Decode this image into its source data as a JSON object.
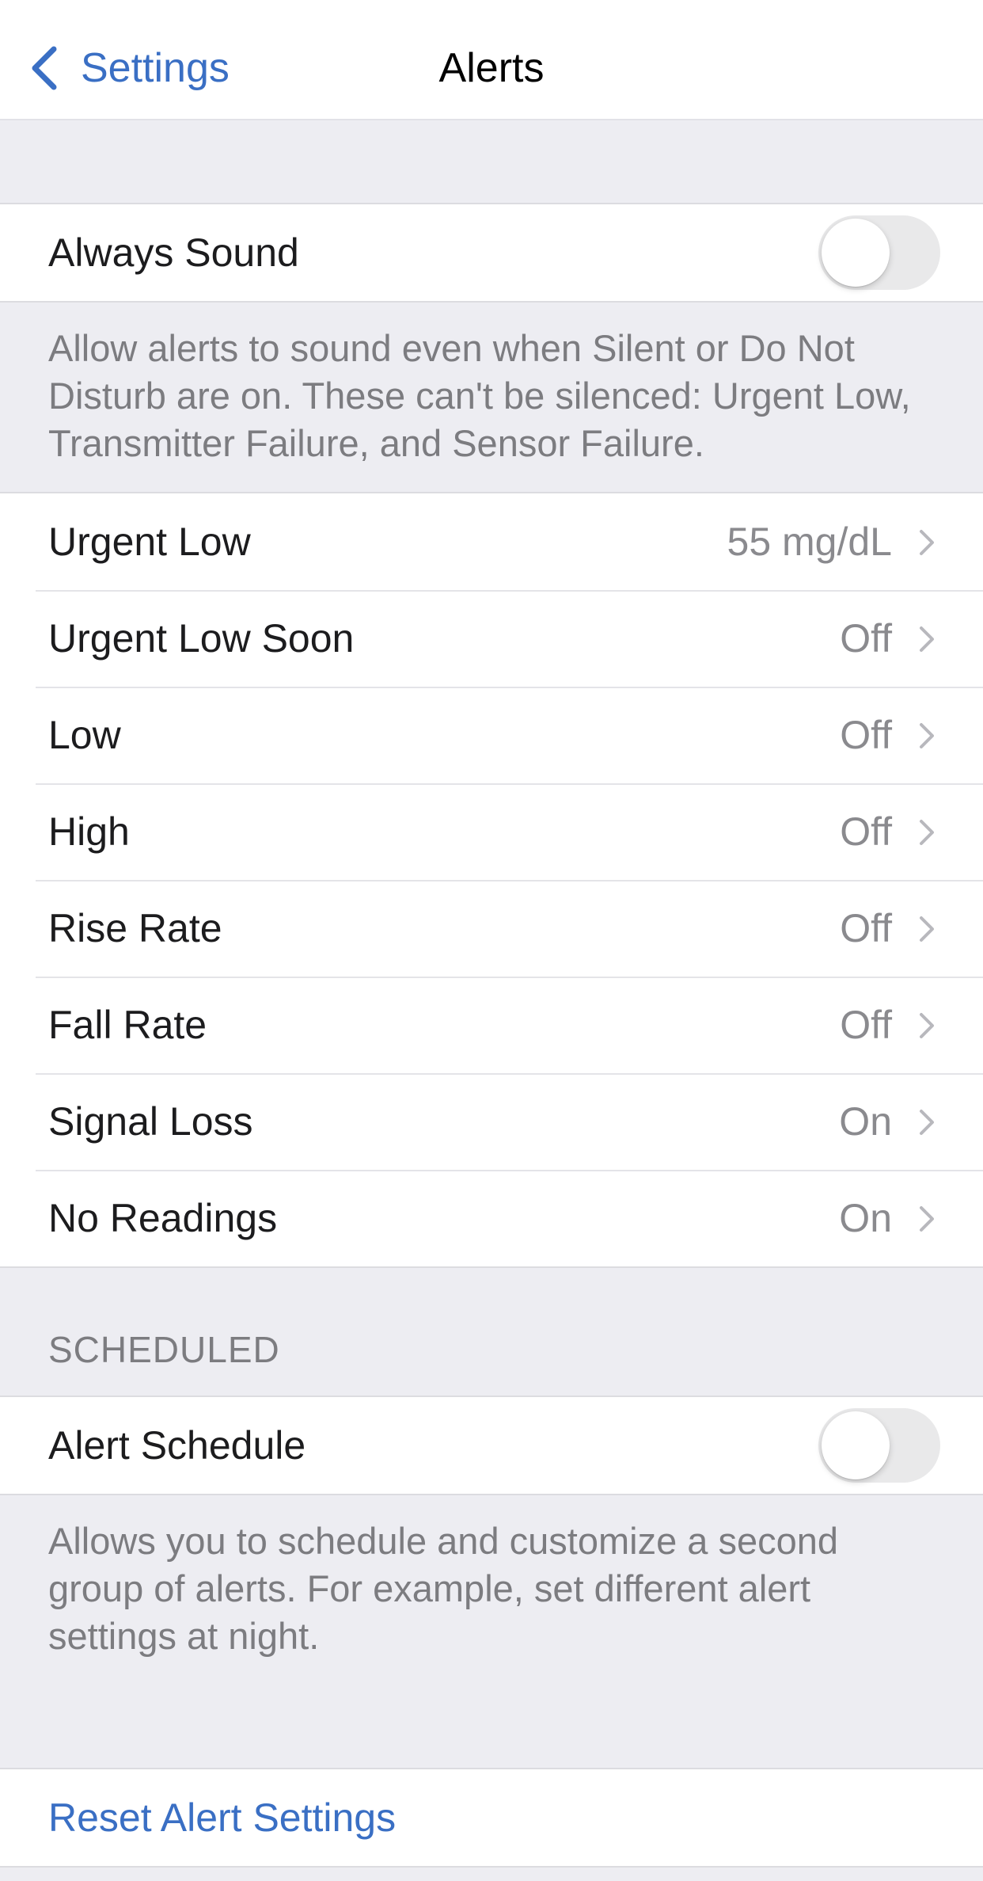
{
  "nav": {
    "back_label": "Settings",
    "title": "Alerts"
  },
  "always_sound": {
    "label": "Always Sound",
    "enabled": false,
    "footnote": "Allow alerts to sound even when Silent or Do Not Disturb are on. These can't be silenced: Urgent Low, Transmitter Failure, and Sensor Failure."
  },
  "alerts": [
    {
      "label": "Urgent Low",
      "value": "55 mg/dL"
    },
    {
      "label": "Urgent Low Soon",
      "value": "Off"
    },
    {
      "label": "Low",
      "value": "Off"
    },
    {
      "label": "High",
      "value": "Off"
    },
    {
      "label": "Rise Rate",
      "value": "Off"
    },
    {
      "label": "Fall Rate",
      "value": "Off"
    },
    {
      "label": "Signal Loss",
      "value": "On"
    },
    {
      "label": "No Readings",
      "value": "On"
    }
  ],
  "scheduled": {
    "header": "SCHEDULED",
    "label": "Alert Schedule",
    "enabled": false,
    "footnote": "Allows you to schedule and customize a second group of alerts. For example, set different alert settings at night."
  },
  "reset": {
    "label": "Reset Alert Settings"
  },
  "colors": {
    "accent": "#3a6fc4",
    "background": "#ededf2",
    "cell": "#ffffff",
    "secondary_text": "#8a8a8e",
    "toggle_off": "#e9e9ea"
  },
  "icons": {
    "back": "chevron-left-icon",
    "disclosure": "chevron-right-icon"
  }
}
